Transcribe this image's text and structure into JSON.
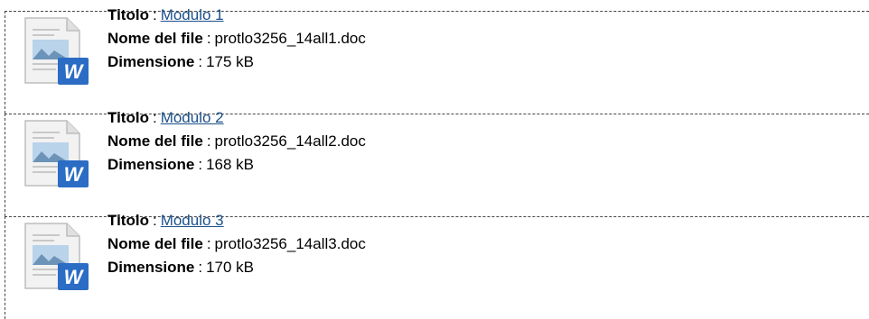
{
  "labels": {
    "title": "Titolo",
    "filename": "Nome del file",
    "size": "Dimensione",
    "separator": ":"
  },
  "files": [
    {
      "title": "Modulo 1",
      "filename": "protlo3256_14all1.doc",
      "size": "175 kB",
      "icon": "word-document-icon"
    },
    {
      "title": "Modulo 2",
      "filename": "protlo3256_14all2.doc",
      "size": "168 kB",
      "icon": "word-document-icon"
    },
    {
      "title": "Modulo 3",
      "filename": "protlo3256_14all3.doc",
      "size": "170 kB",
      "icon": "word-document-icon"
    }
  ],
  "colors": {
    "link": "#1a4f8a",
    "word_blue": "#2b6cc4",
    "border": "#444444"
  }
}
